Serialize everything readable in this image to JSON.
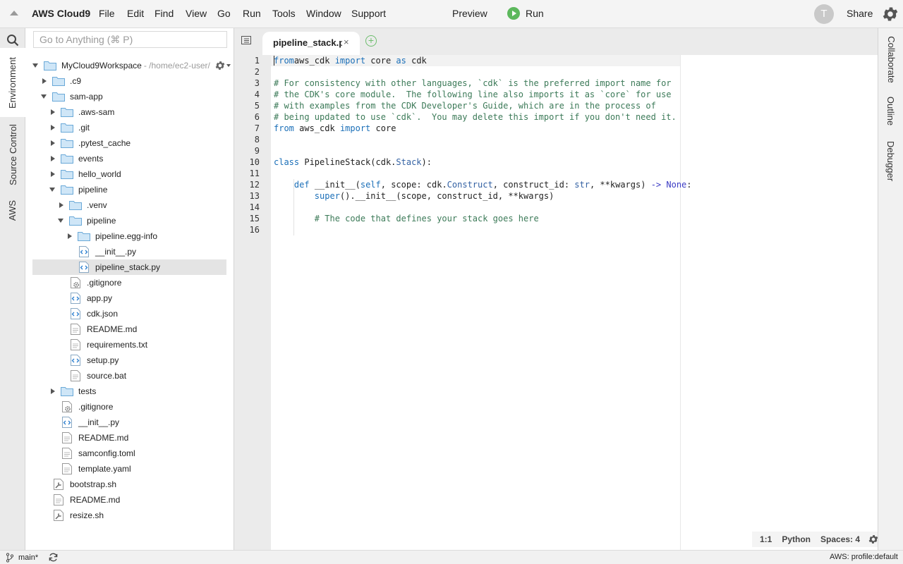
{
  "app": {
    "brand": "AWS Cloud9",
    "menus": [
      "File",
      "Edit",
      "Find",
      "View",
      "Go",
      "Run",
      "Tools",
      "Window",
      "Support"
    ],
    "preview_label": "Preview",
    "run_label": "Run",
    "avatar_initial": "T",
    "share_label": "Share"
  },
  "left_tabs": [
    "Environment",
    "Source Control",
    "AWS"
  ],
  "right_tabs": [
    "Collaborate",
    "Outline",
    "Debugger"
  ],
  "environment": {
    "search_placeholder": "Go to Anything (⌘ P)",
    "workspace_name": "MyCloud9Workspace",
    "workspace_path": "- /home/ec2-user/",
    "tree": [
      {
        "label": ".c9",
        "depth": 1,
        "type": "folder",
        "state": "collapsed"
      },
      {
        "label": "sam-app",
        "depth": 1,
        "type": "folder",
        "state": "expanded"
      },
      {
        "label": ".aws-sam",
        "depth": 2,
        "type": "folder",
        "state": "collapsed"
      },
      {
        "label": ".git",
        "depth": 2,
        "type": "folder",
        "state": "collapsed"
      },
      {
        "label": ".pytest_cache",
        "depth": 2,
        "type": "folder",
        "state": "collapsed"
      },
      {
        "label": "events",
        "depth": 2,
        "type": "folder",
        "state": "collapsed"
      },
      {
        "label": "hello_world",
        "depth": 2,
        "type": "folder",
        "state": "collapsed"
      },
      {
        "label": "pipeline",
        "depth": 2,
        "type": "folder",
        "state": "expanded"
      },
      {
        "label": ".venv",
        "depth": 3,
        "type": "folder",
        "state": "collapsed"
      },
      {
        "label": "pipeline",
        "depth": 3,
        "type": "folder",
        "state": "expanded"
      },
      {
        "label": "pipeline.egg-info",
        "depth": 4,
        "type": "folder",
        "state": "collapsed"
      },
      {
        "label": "__init__.py",
        "depth": 4,
        "type": "code"
      },
      {
        "label": "pipeline_stack.py",
        "depth": 4,
        "type": "code",
        "selected": true
      },
      {
        "label": ".gitignore",
        "depth": 3,
        "type": "config"
      },
      {
        "label": "app.py",
        "depth": 3,
        "type": "code"
      },
      {
        "label": "cdk.json",
        "depth": 3,
        "type": "code"
      },
      {
        "label": "README.md",
        "depth": 3,
        "type": "text"
      },
      {
        "label": "requirements.txt",
        "depth": 3,
        "type": "text"
      },
      {
        "label": "setup.py",
        "depth": 3,
        "type": "code"
      },
      {
        "label": "source.bat",
        "depth": 3,
        "type": "text"
      },
      {
        "label": "tests",
        "depth": 2,
        "type": "folder",
        "state": "collapsed"
      },
      {
        "label": ".gitignore",
        "depth": 2,
        "type": "config"
      },
      {
        "label": "__init__.py",
        "depth": 2,
        "type": "code"
      },
      {
        "label": "README.md",
        "depth": 2,
        "type": "text"
      },
      {
        "label": "samconfig.toml",
        "depth": 2,
        "type": "text"
      },
      {
        "label": "template.yaml",
        "depth": 2,
        "type": "text"
      },
      {
        "label": "bootstrap.sh",
        "depth": 1,
        "type": "script"
      },
      {
        "label": "README.md",
        "depth": 1,
        "type": "text"
      },
      {
        "label": "resize.sh",
        "depth": 1,
        "type": "script"
      }
    ]
  },
  "editor": {
    "active_tab": "pipeline_stack.py",
    "close_glyph": "×",
    "new_tab_glyph": "+",
    "lines": [
      [
        [
          "kw",
          "from"
        ],
        [
          "",
          "&nbsp;aws_cdk "
        ],
        [
          "kw",
          "import"
        ],
        [
          "",
          " core "
        ],
        [
          "kw",
          "as"
        ],
        [
          "",
          " cdk"
        ]
      ],
      [],
      [
        [
          "cm",
          "# For consistency with other languages, `cdk` is the preferred import name for"
        ]
      ],
      [
        [
          "cm",
          "# the CDK's core module.  The following line also imports it as `core` for use"
        ]
      ],
      [
        [
          "cm",
          "# with examples from the CDK Developer's Guide, which are in the process of"
        ]
      ],
      [
        [
          "cm",
          "# being updated to use `cdk`.  You may delete this import if you don't need it."
        ]
      ],
      [
        [
          "kw",
          "from"
        ],
        [
          "",
          " aws_cdk "
        ],
        [
          "kw",
          "import"
        ],
        [
          "",
          " core"
        ]
      ],
      [],
      [],
      [
        [
          "kw",
          "class"
        ],
        [
          "",
          " PipelineStack(cdk."
        ],
        [
          "cls",
          "Stack"
        ],
        [
          "",
          "):"
        ]
      ],
      [],
      [
        [
          "",
          "    "
        ],
        [
          "kw",
          "def"
        ],
        [
          "",
          " __init__("
        ],
        [
          "slf",
          "self"
        ],
        [
          "",
          ", scope: cdk."
        ],
        [
          "cls",
          "Construct"
        ],
        [
          "",
          ", construct_id: "
        ],
        [
          "cls",
          "str"
        ],
        [
          "",
          ", **kwargs) "
        ],
        [
          "sp",
          "->"
        ],
        [
          "",
          " "
        ],
        [
          "sp",
          "None"
        ],
        [
          "",
          ":"
        ]
      ],
      [
        [
          "",
          "        "
        ],
        [
          "slf",
          "super"
        ],
        [
          "",
          "().__init__(scope, construct_id, **kwargs)"
        ]
      ],
      [],
      [
        [
          "",
          "        "
        ],
        [
          "cm",
          "# The code that defines your stack goes here"
        ]
      ],
      []
    ]
  },
  "status": {
    "cursor_pos": "1:1",
    "language": "Python",
    "spaces": "Spaces: 4"
  },
  "bottom": {
    "branch": "main*",
    "profile": "AWS: profile:default"
  }
}
